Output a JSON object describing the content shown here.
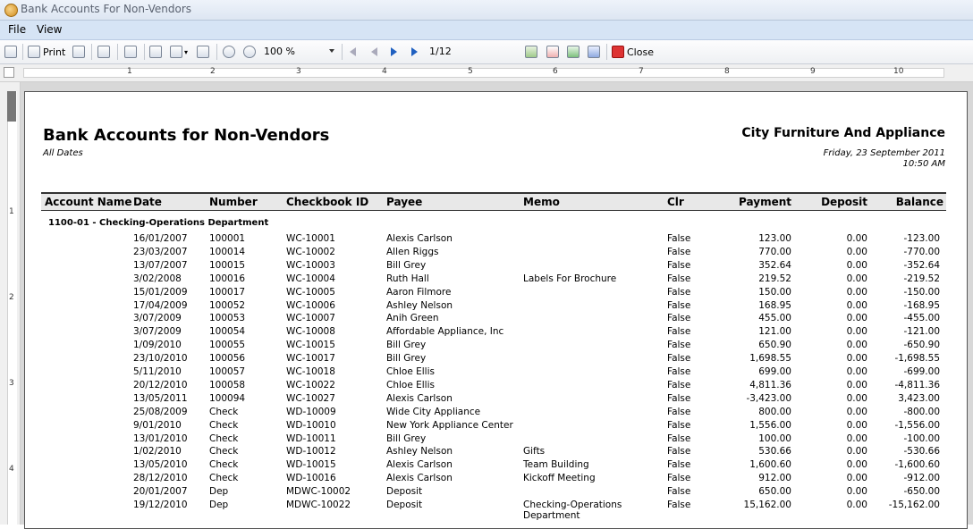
{
  "window": {
    "title": "Bank Accounts For Non-Vendors"
  },
  "menu": [
    "File",
    "View"
  ],
  "toolbar": {
    "print_label": "Print",
    "zoom": "100 %",
    "page_indicator": "1/12",
    "close_label": "Close"
  },
  "ruler": {
    "h_numbers": [
      "1",
      "2",
      "3",
      "4",
      "5",
      "6",
      "7",
      "8",
      "9",
      "10"
    ],
    "v_numbers": [
      "1",
      "2",
      "3",
      "4"
    ]
  },
  "report": {
    "title": "Bank Accounts for Non-Vendors",
    "subtitle": "All Dates",
    "company": "City Furniture And Appliance",
    "date": "Friday, 23 September 2011",
    "time": "10:50 AM",
    "columns": [
      "Account Name",
      "Date",
      "Number",
      "Checkbook ID",
      "Payee",
      "Memo",
      "Clr",
      "Payment",
      "Deposit",
      "Balance"
    ],
    "group": "1100-01 - Checking-Operations Department",
    "rows": [
      {
        "date": "16/01/2007",
        "number": "100001",
        "checkbook": "WC-10001",
        "payee": "Alexis  Carlson",
        "memo": "",
        "clr": "False",
        "payment": "123.00",
        "deposit": "0.00",
        "balance": "-123.00"
      },
      {
        "date": "23/03/2007",
        "number": "100014",
        "checkbook": "WC-10002",
        "payee": "Allen Riggs",
        "memo": "",
        "clr": "False",
        "payment": "770.00",
        "deposit": "0.00",
        "balance": "-770.00"
      },
      {
        "date": "13/07/2007",
        "number": "100015",
        "checkbook": "WC-10003",
        "payee": "Bill Grey",
        "memo": "",
        "clr": "False",
        "payment": "352.64",
        "deposit": "0.00",
        "balance": "-352.64"
      },
      {
        "date": "3/02/2008",
        "number": "100016",
        "checkbook": "WC-10004",
        "payee": "Ruth Hall",
        "memo": "Labels For Brochure",
        "clr": "False",
        "payment": "219.52",
        "deposit": "0.00",
        "balance": "-219.52"
      },
      {
        "date": "15/01/2009",
        "number": "100017",
        "checkbook": "WC-10005",
        "payee": "Aaron Filmore",
        "memo": "",
        "clr": "False",
        "payment": "150.00",
        "deposit": "0.00",
        "balance": "-150.00"
      },
      {
        "date": "17/04/2009",
        "number": "100052",
        "checkbook": "WC-10006",
        "payee": "Ashley  Nelson",
        "memo": "",
        "clr": "False",
        "payment": "168.95",
        "deposit": "0.00",
        "balance": "-168.95"
      },
      {
        "date": "3/07/2009",
        "number": "100053",
        "checkbook": "WC-10007",
        "payee": "Anih Green",
        "memo": "",
        "clr": "False",
        "payment": "455.00",
        "deposit": "0.00",
        "balance": "-455.00"
      },
      {
        "date": "3/07/2009",
        "number": "100054",
        "checkbook": "WC-10008",
        "payee": "Affordable Appliance, Inc",
        "memo": "",
        "clr": "False",
        "payment": "121.00",
        "deposit": "0.00",
        "balance": "-121.00"
      },
      {
        "date": "1/09/2010",
        "number": "100055",
        "checkbook": "WC-10015",
        "payee": "Bill Grey",
        "memo": "",
        "clr": "False",
        "payment": "650.90",
        "deposit": "0.00",
        "balance": "-650.90"
      },
      {
        "date": "23/10/2010",
        "number": "100056",
        "checkbook": "WC-10017",
        "payee": "Bill Grey",
        "memo": "",
        "clr": "False",
        "payment": "1,698.55",
        "deposit": "0.00",
        "balance": "-1,698.55"
      },
      {
        "date": "5/11/2010",
        "number": "100057",
        "checkbook": "WC-10018",
        "payee": "Chloe Ellis",
        "memo": "",
        "clr": "False",
        "payment": "699.00",
        "deposit": "0.00",
        "balance": "-699.00"
      },
      {
        "date": "20/12/2010",
        "number": "100058",
        "checkbook": "WC-10022",
        "payee": "Chloe Ellis",
        "memo": "",
        "clr": "False",
        "payment": "4,811.36",
        "deposit": "0.00",
        "balance": "-4,811.36"
      },
      {
        "date": "13/05/2011",
        "number": "100094",
        "checkbook": "WC-10027",
        "payee": "Alexis  Carlson",
        "memo": "",
        "clr": "False",
        "payment": "-3,423.00",
        "deposit": "0.00",
        "balance": "3,423.00"
      },
      {
        "date": "25/08/2009",
        "number": "Check",
        "checkbook": "WD-10009",
        "payee": "Wide City Appliance",
        "memo": "",
        "clr": "False",
        "payment": "800.00",
        "deposit": "0.00",
        "balance": "-800.00"
      },
      {
        "date": "9/01/2010",
        "number": "Check",
        "checkbook": "WD-10010",
        "payee": "New York Appliance Center",
        "memo": "",
        "clr": "False",
        "payment": "1,556.00",
        "deposit": "0.00",
        "balance": "-1,556.00"
      },
      {
        "date": "13/01/2010",
        "number": "Check",
        "checkbook": "WD-10011",
        "payee": "Bill Grey",
        "memo": "",
        "clr": "False",
        "payment": "100.00",
        "deposit": "0.00",
        "balance": "-100.00"
      },
      {
        "date": "1/02/2010",
        "number": "Check",
        "checkbook": "WD-10012",
        "payee": "Ashley  Nelson",
        "memo": "Gifts",
        "clr": "False",
        "payment": "530.66",
        "deposit": "0.00",
        "balance": "-530.66"
      },
      {
        "date": "13/05/2010",
        "number": "Check",
        "checkbook": "WD-10015",
        "payee": "Alexis  Carlson",
        "memo": "Team Building",
        "clr": "False",
        "payment": "1,600.60",
        "deposit": "0.00",
        "balance": "-1,600.60"
      },
      {
        "date": "28/12/2010",
        "number": "Check",
        "checkbook": "WD-10016",
        "payee": "Alexis  Carlson",
        "memo": "Kickoff Meeting",
        "clr": "False",
        "payment": "912.00",
        "deposit": "0.00",
        "balance": "-912.00"
      },
      {
        "date": "20/01/2007",
        "number": "Dep",
        "checkbook": "MDWC-10002",
        "payee": "Deposit",
        "memo": "",
        "clr": "False",
        "payment": "650.00",
        "deposit": "0.00",
        "balance": "-650.00"
      },
      {
        "date": "19/12/2010",
        "number": "Dep",
        "checkbook": "MDWC-10022",
        "payee": "Deposit",
        "memo": "Checking-Operations Department",
        "clr": "False",
        "payment": "15,162.00",
        "deposit": "0.00",
        "balance": "-15,162.00"
      }
    ]
  }
}
